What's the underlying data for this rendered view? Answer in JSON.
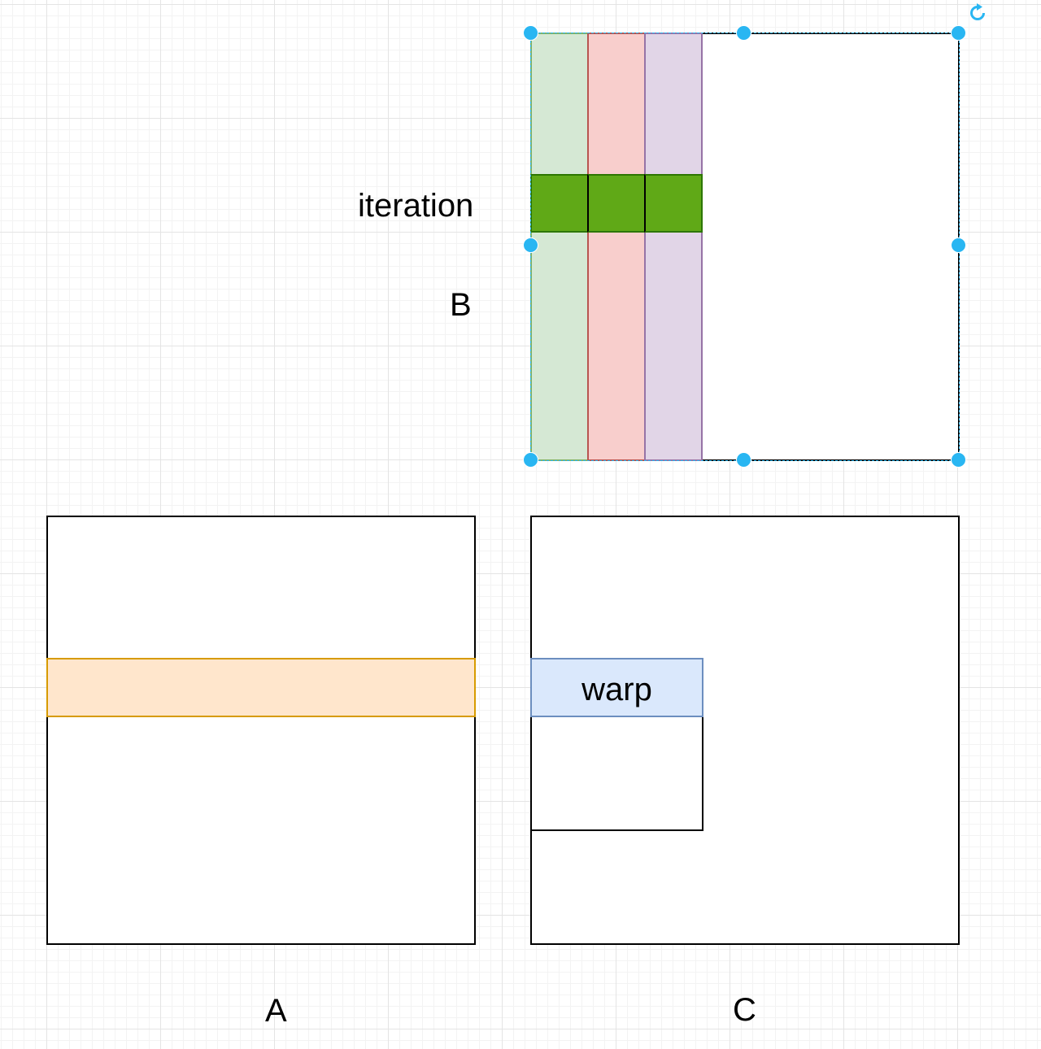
{
  "diagram": {
    "labels": {
      "iteration": "iteration",
      "b": "B",
      "a": "A",
      "c": "C",
      "warp": "warp"
    },
    "colors": {
      "green_column_fill": "#d5e8d4",
      "green_column_stroke": "#82b366",
      "red_column_fill": "#f8cecc",
      "red_column_stroke": "#b85450",
      "purple_column_fill": "#e1d5e7",
      "purple_column_stroke": "#9673a6",
      "iteration_tile_fill": "#60a917",
      "iteration_tile_stroke": "#2d7600",
      "a_row_fill": "#ffe6cc",
      "a_row_stroke": "#d79b00",
      "warp_fill": "#dae8fc",
      "warp_stroke": "#6c8ebf",
      "selection_accent": "#29b6f2"
    },
    "icons": {
      "rotate": "rotate-icon",
      "resize_handle": "resize-handle-icon"
    }
  }
}
